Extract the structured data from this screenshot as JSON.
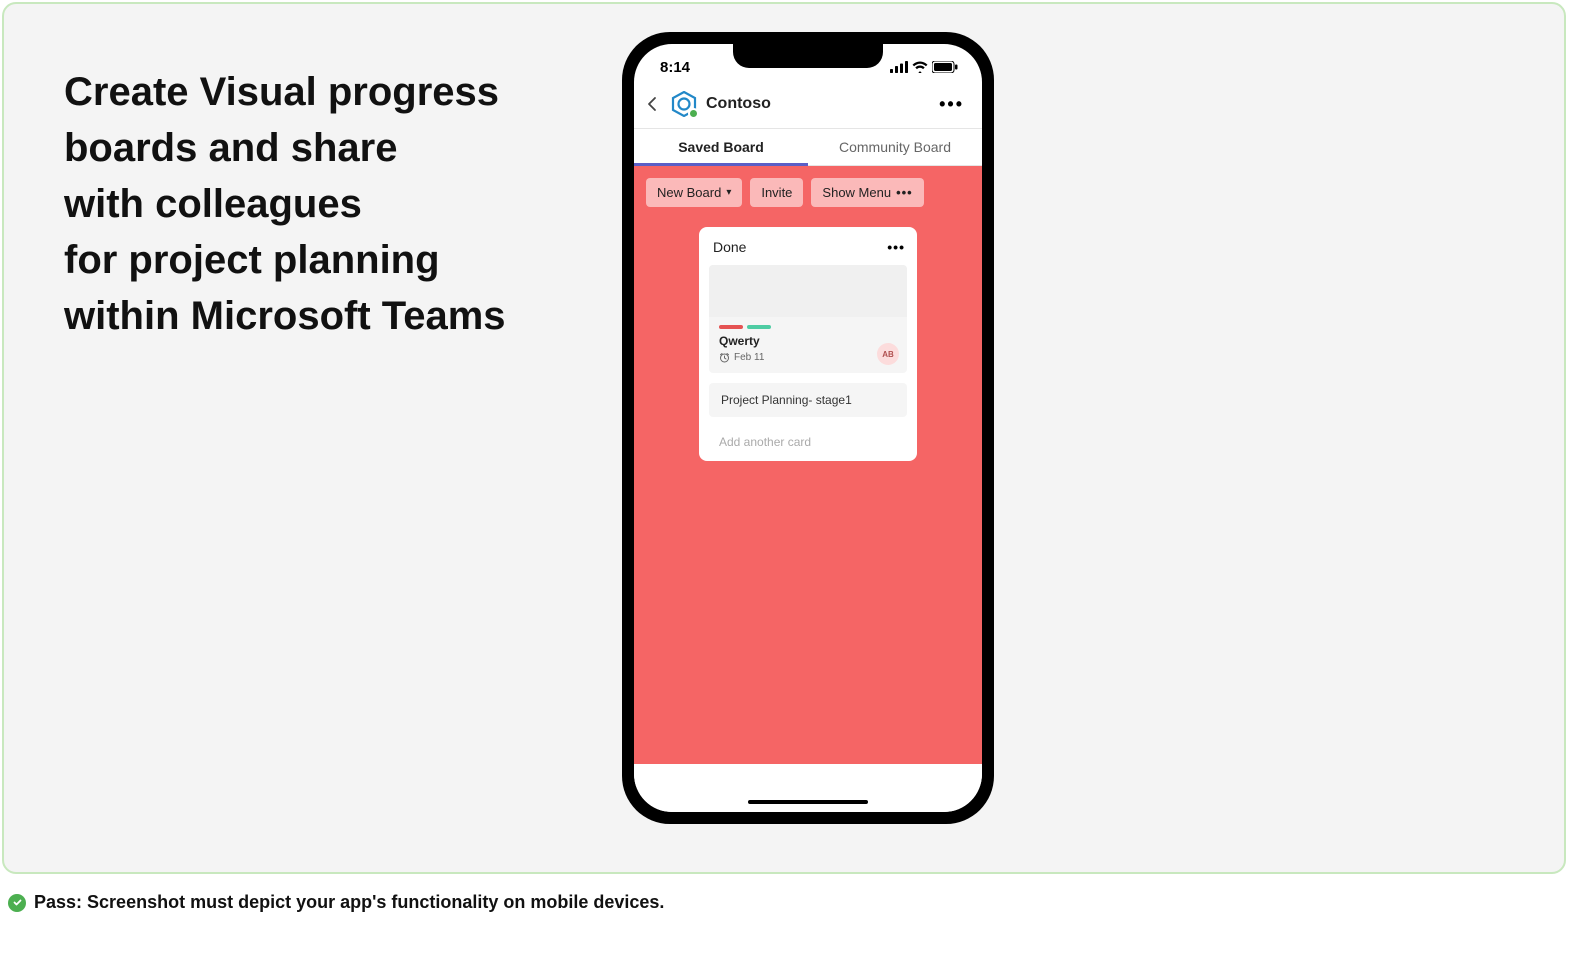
{
  "headline": {
    "line1": "Create Visual progress",
    "line2": "boards and share",
    "line3": "with colleagues",
    "line4": "for project planning",
    "line5": "within Microsoft Teams"
  },
  "status_bar": {
    "time": "8:14"
  },
  "app": {
    "title": "Contoso"
  },
  "tabs": {
    "saved": "Saved Board",
    "community": "Community Board"
  },
  "board_actions": {
    "new_board": "New Board",
    "invite": "Invite",
    "show_menu": "Show Menu"
  },
  "column": {
    "title": "Done",
    "cards": {
      "qwerty": {
        "title": "Qwerty",
        "date": "Feb 11",
        "avatar": "AB"
      },
      "project_planning": "Project Planning- stage1"
    },
    "add_card": "Add another card"
  },
  "footer": {
    "pass": "Pass: Screenshot must depict your app's functionality on mobile devices."
  }
}
